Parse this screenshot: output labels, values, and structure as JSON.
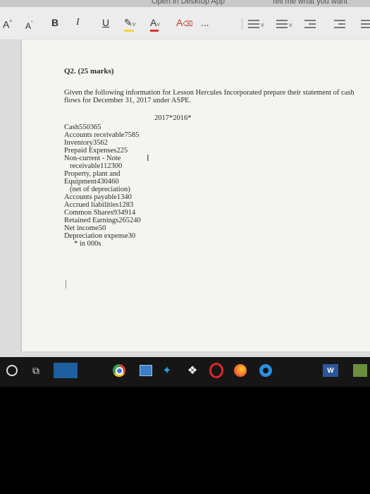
{
  "titlebar": {
    "center_text": "Open in Desktop App",
    "tell_me": "Tell me what you want"
  },
  "ribbon": {
    "grow_font": "A",
    "shrink_font": "A",
    "bold": "B",
    "italic": "I",
    "underline": "U",
    "font_color_letter": "A",
    "clear_format_letter": "A",
    "more": "...",
    "colors": {
      "highlight": "#f2d33a",
      "font_color": "#d9342b",
      "clear_format": "#c0392b"
    }
  },
  "document": {
    "question": "Q2. (25 marks)",
    "instruction": "Given the following information for Lesson Hercules Incorporated prepare their statement of cash flows for December 31, 2017 under ASPE.",
    "years": "2017*2016*",
    "items": [
      "Cash550365",
      "Accounts receivable7585",
      "Inventory3562",
      "Prepaid Expenses225",
      "Non-current - Note",
      "receivable112300",
      "Property, plant and",
      "Equipment430460",
      "(net of depreciation)",
      "Accounts payable1340",
      "Accrued liabilities1283",
      "Common Shares934914",
      "Retained Earnings265240",
      "Net income50",
      "Depreciation expense30",
      "* in 000s"
    ]
  },
  "taskbar": {
    "icons": [
      "start-icon",
      "task-view-icon",
      "chrome-icon",
      "photos-icon",
      "pin-icon",
      "dropbox-icon",
      "opera-icon",
      "firefox-icon",
      "edge-icon",
      "word-icon",
      "app-icon"
    ],
    "word_letter": "W"
  }
}
